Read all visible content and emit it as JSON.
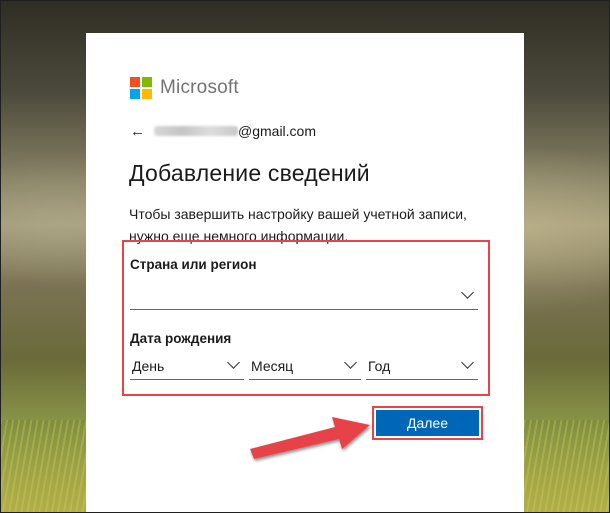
{
  "brand": {
    "name": "Microsoft",
    "colors": [
      "#f25022",
      "#7fba00",
      "#00a4ef",
      "#ffb900"
    ]
  },
  "identity": {
    "back_icon": "arrow-left-icon",
    "email_domain": "@gmail.com"
  },
  "title": "Добавление сведений",
  "description": "Чтобы завершить настройку вашей учетной записи, нужно еще немного информации.",
  "country": {
    "label": "Страна или регион",
    "value": ""
  },
  "birthdate": {
    "label": "Дата рождения",
    "day": "День",
    "month": "Месяц",
    "year": "Год"
  },
  "next_button": "Далее",
  "colors": {
    "accent": "#0067b8",
    "highlight": "#e8424a"
  }
}
